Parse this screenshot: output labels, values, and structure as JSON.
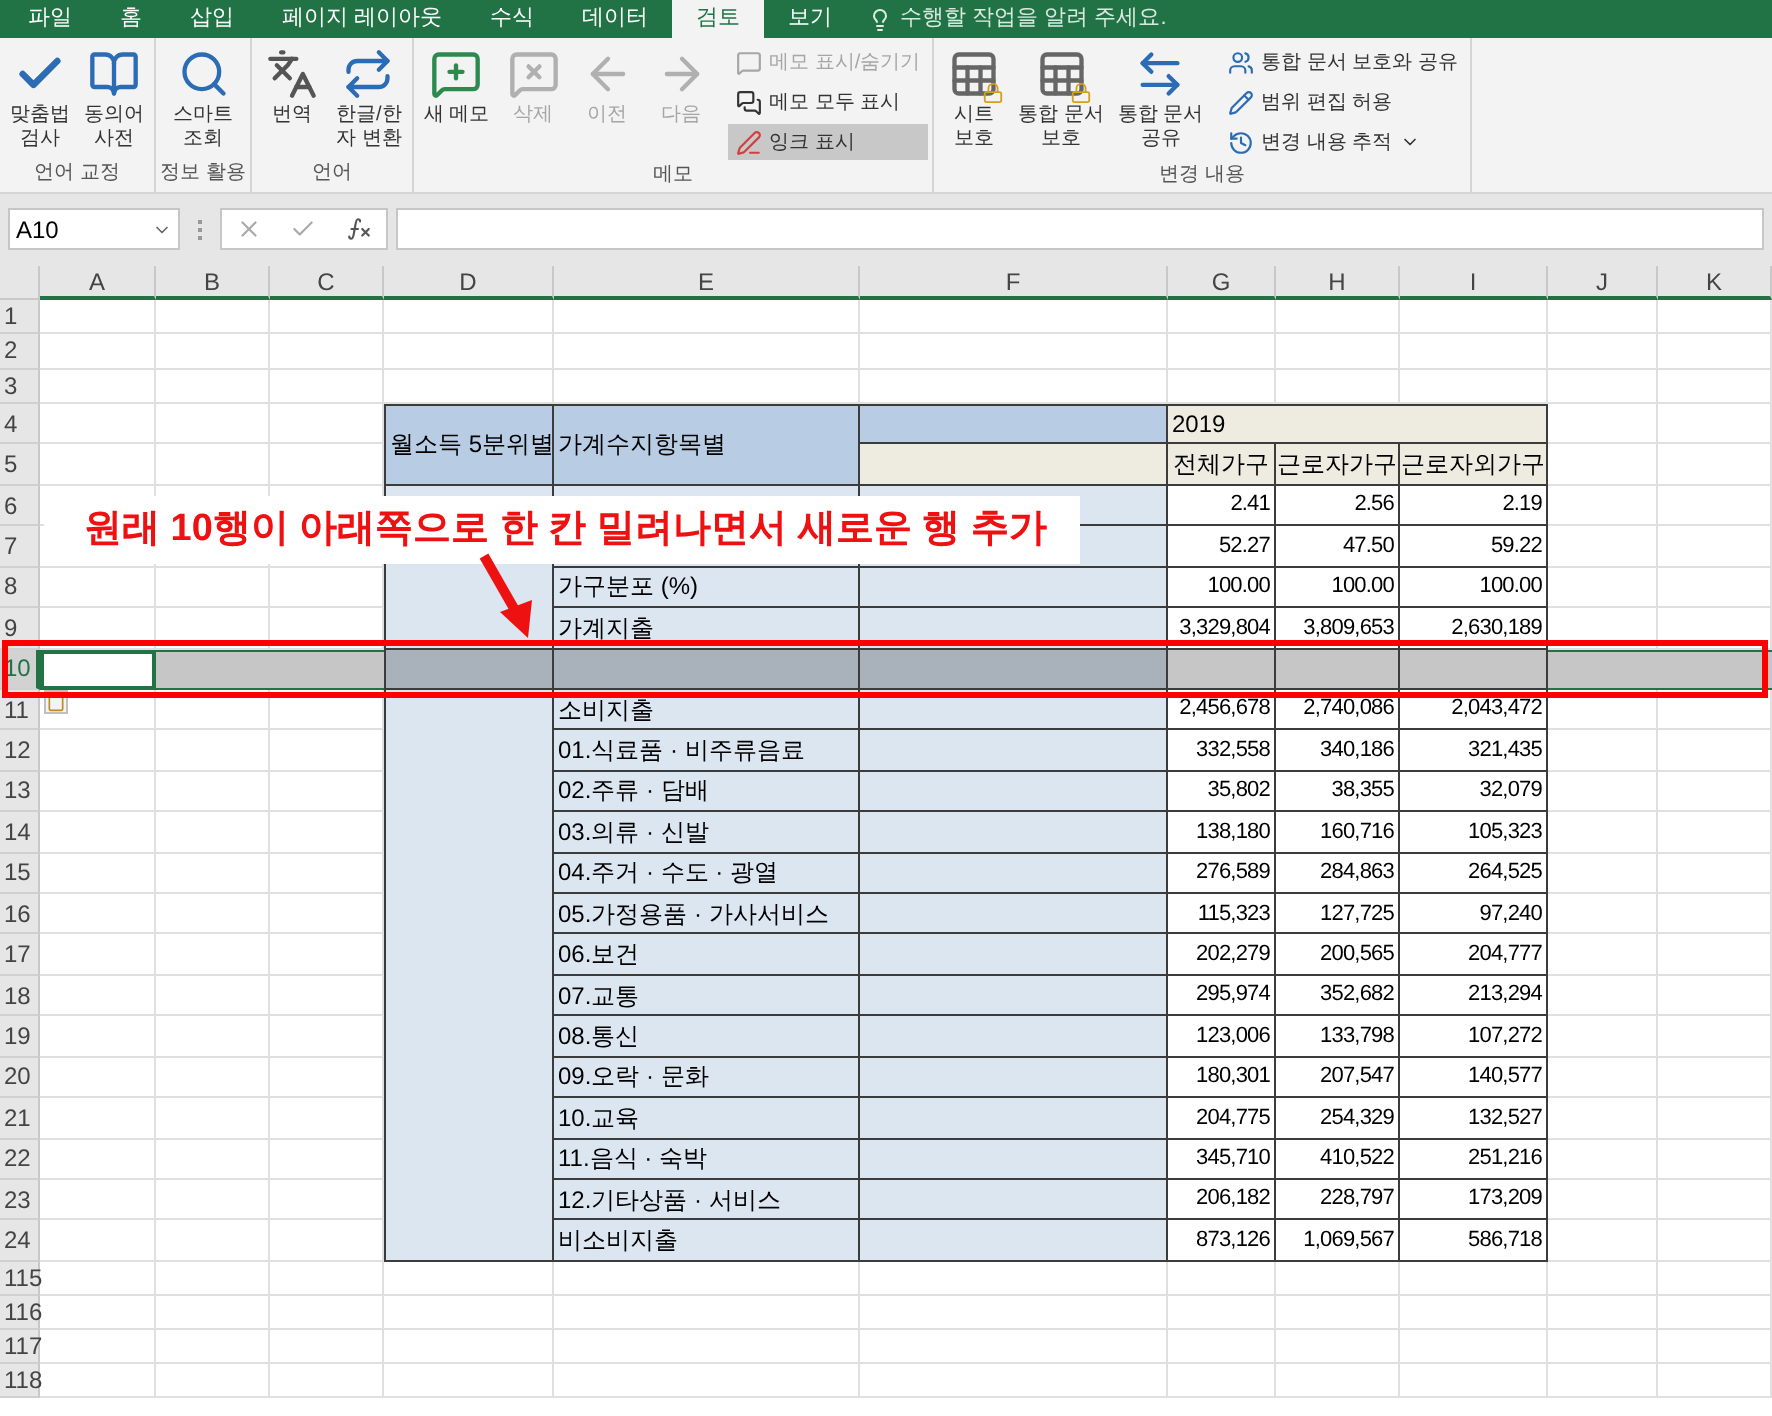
{
  "tabs": [
    {
      "label": "파일",
      "selected": false
    },
    {
      "label": "홈",
      "selected": false
    },
    {
      "label": "삽입",
      "selected": false
    },
    {
      "label": "페이지 레이아웃",
      "selected": false
    },
    {
      "label": "수식",
      "selected": false
    },
    {
      "label": "데이터",
      "selected": false
    },
    {
      "label": "검토",
      "selected": true
    },
    {
      "label": "보기",
      "selected": false
    }
  ],
  "tell_me": {
    "placeholder": "수행할 작업을 알려 주세요."
  },
  "ribbon": {
    "groups": [
      {
        "label": "언어 교정",
        "buttons": [
          {
            "kind": "large",
            "lines": [
              "맞춤법",
              "검사"
            ],
            "disabled": false,
            "on": false,
            "menu": false
          },
          {
            "kind": "large",
            "lines": [
              "동의어",
              "사전"
            ],
            "disabled": false,
            "on": false,
            "menu": false
          }
        ]
      },
      {
        "label": "정보 활용",
        "buttons": [
          {
            "kind": "large",
            "lines": [
              "스마트",
              "조회"
            ],
            "disabled": false,
            "on": false,
            "menu": false
          }
        ]
      },
      {
        "label": "언어",
        "buttons": [
          {
            "kind": "large",
            "lines": [
              "번역"
            ],
            "disabled": false,
            "on": false,
            "menu": false
          },
          {
            "kind": "large",
            "lines": [
              "한글/한",
              "자 변환"
            ],
            "disabled": false,
            "on": false,
            "menu": false
          }
        ]
      },
      {
        "label": "메모",
        "buttons": [
          {
            "kind": "large",
            "lines": [
              "새 메모"
            ],
            "disabled": false,
            "on": false,
            "menu": false
          },
          {
            "kind": "large",
            "lines": [
              "삭제"
            ],
            "disabled": true,
            "on": false,
            "menu": false
          },
          {
            "kind": "large",
            "lines": [
              "이전"
            ],
            "disabled": true,
            "on": false,
            "menu": false
          },
          {
            "kind": "large",
            "lines": [
              "다음"
            ],
            "disabled": true,
            "on": false,
            "menu": false
          },
          {
            "kind": "small",
            "lines": [
              "메모 표시/숨기기"
            ],
            "disabled": true,
            "on": false,
            "menu": false
          },
          {
            "kind": "small",
            "lines": [
              "메모 모두 표시"
            ],
            "disabled": false,
            "on": false,
            "menu": false
          },
          {
            "kind": "small",
            "lines": [
              "잉크 표시"
            ],
            "disabled": false,
            "on": true,
            "menu": false
          }
        ]
      },
      {
        "label": "변경 내용",
        "buttons": [
          {
            "kind": "large",
            "lines": [
              "시트",
              "보호"
            ],
            "disabled": false,
            "on": false,
            "menu": false
          },
          {
            "kind": "large",
            "lines": [
              "통합 문서",
              "보호"
            ],
            "disabled": false,
            "on": false,
            "menu": false
          },
          {
            "kind": "large",
            "lines": [
              "통합 문서",
              "공유"
            ],
            "disabled": false,
            "on": false,
            "menu": false
          },
          {
            "kind": "small",
            "lines": [
              "통합 문서 보호와 공유"
            ],
            "disabled": false,
            "on": false,
            "menu": false
          },
          {
            "kind": "small",
            "lines": [
              "범위 편집 허용"
            ],
            "disabled": false,
            "on": false,
            "menu": false
          },
          {
            "kind": "small",
            "lines": [
              "변경 내용 추적"
            ],
            "disabled": false,
            "on": false,
            "menu": true
          }
        ]
      }
    ]
  },
  "formula_bar": {
    "name_box": "A10"
  },
  "sheet": {
    "columns": [
      {
        "label": "A",
        "active": true
      },
      {
        "label": "B",
        "active": false
      },
      {
        "label": "C",
        "active": false
      },
      {
        "label": "D",
        "active": false
      },
      {
        "label": "E",
        "active": false
      },
      {
        "label": "F",
        "active": false
      },
      {
        "label": "G",
        "active": false
      },
      {
        "label": "H",
        "active": false
      },
      {
        "label": "I",
        "active": false
      },
      {
        "label": "J",
        "active": false
      },
      {
        "label": "K",
        "active": false
      }
    ],
    "rows": [
      {
        "label": "1",
        "selected": false
      },
      {
        "label": "2",
        "selected": false
      },
      {
        "label": "3",
        "selected": false
      },
      {
        "label": "4",
        "selected": false
      },
      {
        "label": "5",
        "selected": false
      },
      {
        "label": "6",
        "selected": false
      },
      {
        "label": "7",
        "selected": false
      },
      {
        "label": "8",
        "selected": false
      },
      {
        "label": "9",
        "selected": false
      },
      {
        "label": "10",
        "selected": true
      },
      {
        "label": "11",
        "selected": false
      },
      {
        "label": "12",
        "selected": false
      },
      {
        "label": "13",
        "selected": false
      },
      {
        "label": "14",
        "selected": false
      },
      {
        "label": "15",
        "selected": false
      },
      {
        "label": "16",
        "selected": false
      },
      {
        "label": "17",
        "selected": false
      },
      {
        "label": "18",
        "selected": false
      },
      {
        "label": "19",
        "selected": false
      },
      {
        "label": "20",
        "selected": false
      },
      {
        "label": "21",
        "selected": false
      },
      {
        "label": "22",
        "selected": false
      },
      {
        "label": "23",
        "selected": false
      },
      {
        "label": "24",
        "selected": false
      },
      {
        "label": "115",
        "selected": false
      },
      {
        "label": "116",
        "selected": false
      },
      {
        "label": "117",
        "selected": false
      },
      {
        "label": "118",
        "selected": false
      }
    ]
  },
  "table": {
    "group_header": "월소득 5분위별",
    "item_header": "가계수지항목별",
    "year": "2019",
    "subheaders": [
      "전체가구",
      "근로자가구",
      "근로자외가구"
    ],
    "rows": [
      {
        "kind": "data",
        "values": [
          "2.41",
          "2.56",
          "2.19"
        ]
      },
      {
        "kind": "data",
        "values": [
          "52.27",
          "47.50",
          "59.22"
        ]
      },
      {
        "kind": "data",
        "label": "가구분포 (%)",
        "values": [
          "100.00",
          "100.00",
          "100.00"
        ]
      },
      {
        "kind": "data",
        "label": "가계지출",
        "values": [
          "3,329,804",
          "3,809,653",
          "2,630,189"
        ]
      },
      {
        "kind": "blank"
      },
      {
        "kind": "data",
        "label": "소비지출",
        "values": [
          "2,456,678",
          "2,740,086",
          "2,043,472"
        ]
      },
      {
        "kind": "data",
        "label": "01.식료품 · 비주류음료",
        "values": [
          "332,558",
          "340,186",
          "321,435"
        ]
      },
      {
        "kind": "data",
        "label": "02.주류 · 담배",
        "values": [
          "35,802",
          "38,355",
          "32,079"
        ]
      },
      {
        "kind": "data",
        "label": "03.의류 · 신발",
        "values": [
          "138,180",
          "160,716",
          "105,323"
        ]
      },
      {
        "kind": "data",
        "label": "04.주거 · 수도 · 광열",
        "values": [
          "276,589",
          "284,863",
          "264,525"
        ]
      },
      {
        "kind": "data",
        "label": "05.가정용품 · 가사서비스",
        "values": [
          "115,323",
          "127,725",
          "97,240"
        ]
      },
      {
        "kind": "data",
        "label": "06.보건",
        "values": [
          "202,279",
          "200,565",
          "204,777"
        ]
      },
      {
        "kind": "data",
        "label": "07.교통",
        "values": [
          "295,974",
          "352,682",
          "213,294"
        ]
      },
      {
        "kind": "data",
        "label": "08.통신",
        "values": [
          "123,006",
          "133,798",
          "107,272"
        ]
      },
      {
        "kind": "data",
        "label": "09.오락 · 문화",
        "values": [
          "180,301",
          "207,547",
          "140,577"
        ]
      },
      {
        "kind": "data",
        "label": "10.교육",
        "values": [
          "204,775",
          "254,329",
          "132,527"
        ]
      },
      {
        "kind": "data",
        "label": "11.음식 · 숙박",
        "values": [
          "345,710",
          "410,522",
          "251,216"
        ]
      },
      {
        "kind": "data",
        "label": "12.기타상품 · 서비스",
        "values": [
          "206,182",
          "228,797",
          "173,209"
        ]
      },
      {
        "kind": "data",
        "label": "비소비지출",
        "values": [
          "873,126",
          "1,069,567",
          "586,718"
        ]
      }
    ]
  },
  "annotation": {
    "text": "원래 10행이 아래쪽으로 한 칸 밀려나면서 새로운 행 추가"
  }
}
